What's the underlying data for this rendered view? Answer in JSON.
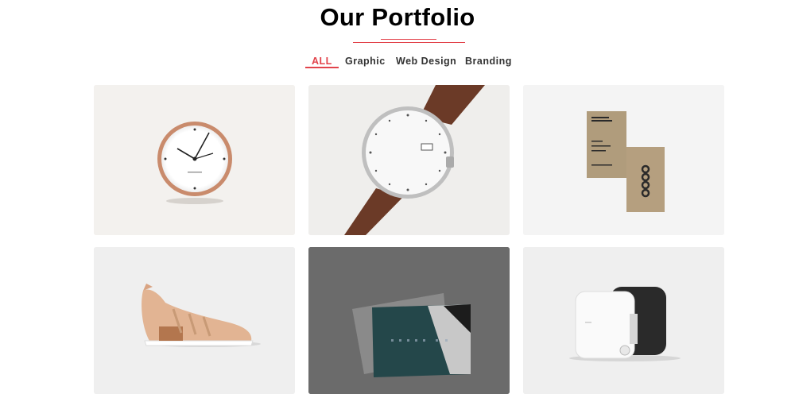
{
  "header": {
    "title": "Our Portfolio"
  },
  "filters": [
    {
      "label": "ALL",
      "active": true
    },
    {
      "label": "Graphic",
      "active": false
    },
    {
      "label": "Web Design",
      "active": false
    },
    {
      "label": "Branding",
      "active": false
    }
  ],
  "colors": {
    "accent": "#e2434b"
  },
  "portfolio_items": [
    {
      "icon": "wall-clock-image"
    },
    {
      "icon": "wrist-watch-image"
    },
    {
      "icon": "business-cards-image"
    },
    {
      "icon": "sneaker-image"
    },
    {
      "icon": "dark-business-card-image"
    },
    {
      "icon": "tape-measure-image"
    }
  ]
}
